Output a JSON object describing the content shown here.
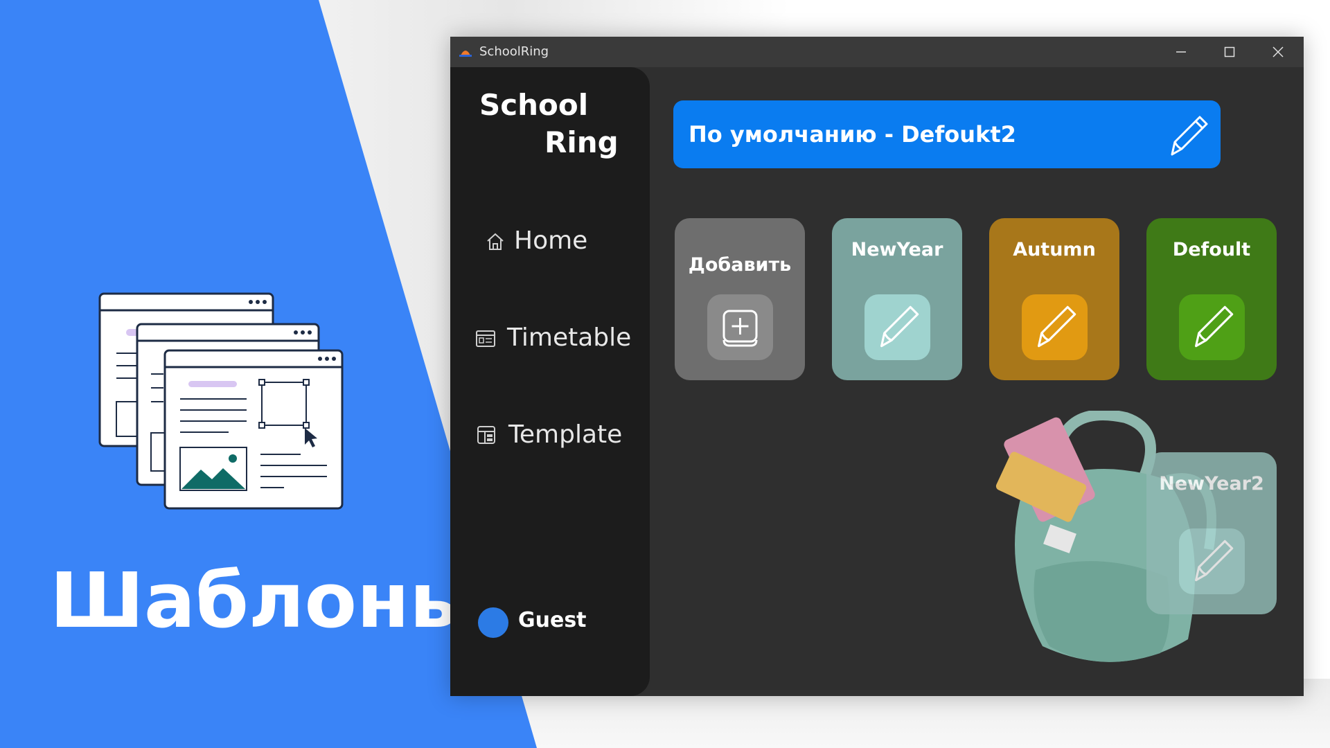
{
  "poster": {
    "title": "Шаблоны",
    "accent_color": "#3a84f7",
    "illustration_icon": "template-windows-illustration"
  },
  "window": {
    "title": "SchoolRing",
    "icon": "schoolring-app-icon",
    "controls": [
      "minimize-icon",
      "maximize-icon",
      "close-icon"
    ]
  },
  "sidebar": {
    "logo_line1": "School",
    "logo_line2": "Ring",
    "items": [
      {
        "label": "Home",
        "icon": "home-icon"
      },
      {
        "label": "Timetable",
        "icon": "calendar-icon"
      },
      {
        "label": "Template",
        "icon": "template-icon"
      }
    ],
    "user": {
      "name": "Guest",
      "icon": "avatar"
    }
  },
  "banner": {
    "text": "По умолчанию - Defoukt2",
    "color": "#0a7cf0",
    "icon": "pencil-icon"
  },
  "cards": [
    {
      "title": "Добавить",
      "icon": "plus-icon",
      "color": "#6e6e6e",
      "button_color": "#8a8a8a"
    },
    {
      "title": "NewYear",
      "icon": "pencil-icon",
      "color": "#7aa39e",
      "button_color": "#9fd3cf"
    },
    {
      "title": "Autumn",
      "icon": "pencil-icon",
      "color": "#a8771a",
      "button_color": "#e19a12"
    },
    {
      "title": "Defoult",
      "icon": "pencil-icon",
      "color": "#3f7a17",
      "button_color": "#4fa016"
    },
    {
      "title": "NewYear2",
      "icon": "pencil-icon",
      "color": "#8fb8b2",
      "button_color": "#a6d4cf"
    }
  ]
}
